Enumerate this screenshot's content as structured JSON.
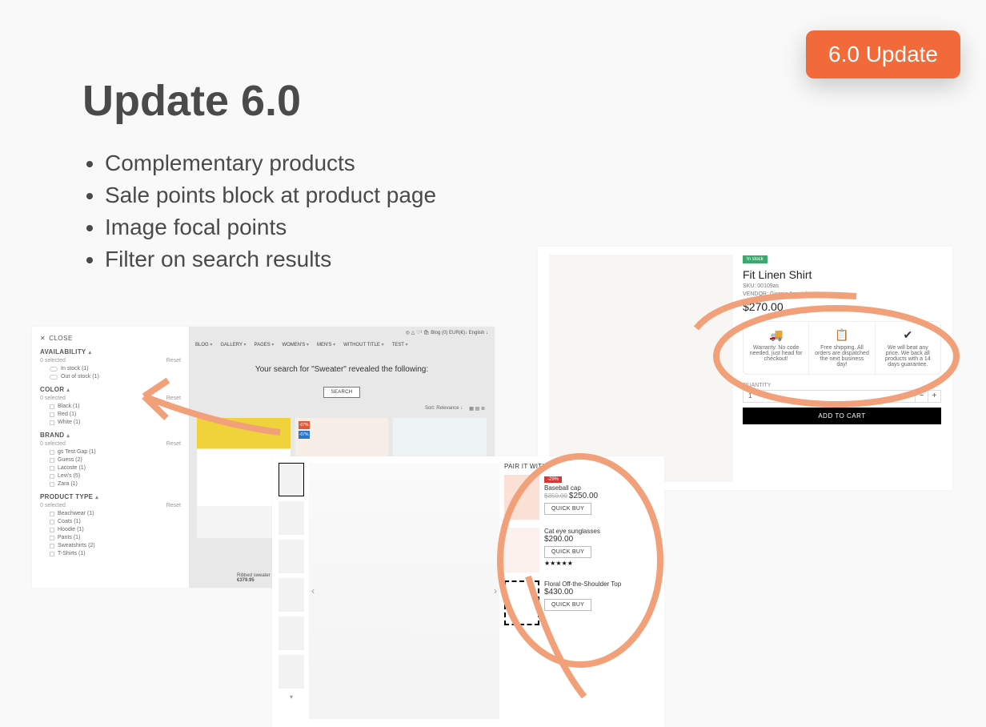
{
  "badge": "6.0 Update",
  "title": "Update 6.0",
  "bullets": [
    "Complementary products",
    "Sale points block at product page",
    "Image focal points",
    "Filter on search results"
  ],
  "filter": {
    "close": "CLOSE",
    "s1": {
      "head": "AVAILABILITY",
      "sel": "0 selected",
      "reset": "Reset",
      "opts": [
        "In stock (1)",
        "Out of stock (1)"
      ]
    },
    "s2": {
      "head": "COLOR",
      "sel": "0 selected",
      "reset": "Reset",
      "opts": [
        "Black (1)",
        "Red (1)",
        "White (1)"
      ]
    },
    "s3": {
      "head": "BRAND",
      "sel": "0 selected",
      "reset": "Reset",
      "opts": [
        "gs Test Gap (1)",
        "Guess (2)",
        "Lacoste (1)",
        "Levi's (5)",
        "Zara (1)"
      ]
    },
    "s4": {
      "head": "PRODUCT TYPE",
      "sel": "0 selected",
      "reset": "Reset",
      "opts": [
        "Beachwear (1)",
        "Coats (1)",
        "Hoodie (1)",
        "Pants (1)",
        "Sweatshirts (2)",
        "T-Shirts (1)"
      ]
    }
  },
  "search": {
    "topicons": "◎ △ ♡¹ 🛍 Blog (0)  EUR(€)↓  English ↓",
    "nav": [
      "BLOG",
      "GALLERY",
      "PAGES",
      "WOMEN'S",
      "MEN'S",
      "WITHOUT TITLE",
      "TEST"
    ],
    "msg": "Your search for \"Sweater\" revealed the following:",
    "btn": "SEARCH",
    "sort": "Sort: Relevance ↓",
    "cards": [
      {
        "label": "",
        "name": "",
        "price": ""
      },
      {
        "label": "-07%",
        "labelColor": "#e05a3a",
        "name2": "-07%",
        "name": "",
        "price": ""
      },
      {
        "label": "",
        "name": "",
        "price": ""
      }
    ],
    "foot_name": "Ribbed sweater",
    "foot_price": "€379.95"
  },
  "prod": {
    "stock": "In stock",
    "name": "Fit Linen Shirt",
    "sku": "SKU: 00109as",
    "vendor": "VENDOR: Giorgio Armani",
    "price": "$270.00",
    "sp": [
      {
        "ic": "🚚",
        "txt": "Warranty. No code needed, just head for checkout!"
      },
      {
        "ic": "📋",
        "txt": "Free shipping. All orders are dispatched the next business day!"
      },
      {
        "ic": "✔",
        "txt": "We will beat any price. We back all products with a 14 days guarantee."
      }
    ],
    "qtyl": "QUANTITY",
    "qty": "1",
    "add": "ADD TO CART"
  },
  "pair": {
    "head": "PAIR IT WITH",
    "items": [
      {
        "disc": "-29%",
        "name": "Baseball cap",
        "old": "$350.00",
        "price": "$250.00",
        "btn": "QUICK BUY"
      },
      {
        "name": "Cat eye sunglasses",
        "price": "$290.00",
        "btn": "QUICK BUY",
        "stars": "★★★★★"
      },
      {
        "name": "Floral Off-the-Shoulder Top",
        "price": "$430.00",
        "btn": "QUICK BUY"
      }
    ]
  }
}
